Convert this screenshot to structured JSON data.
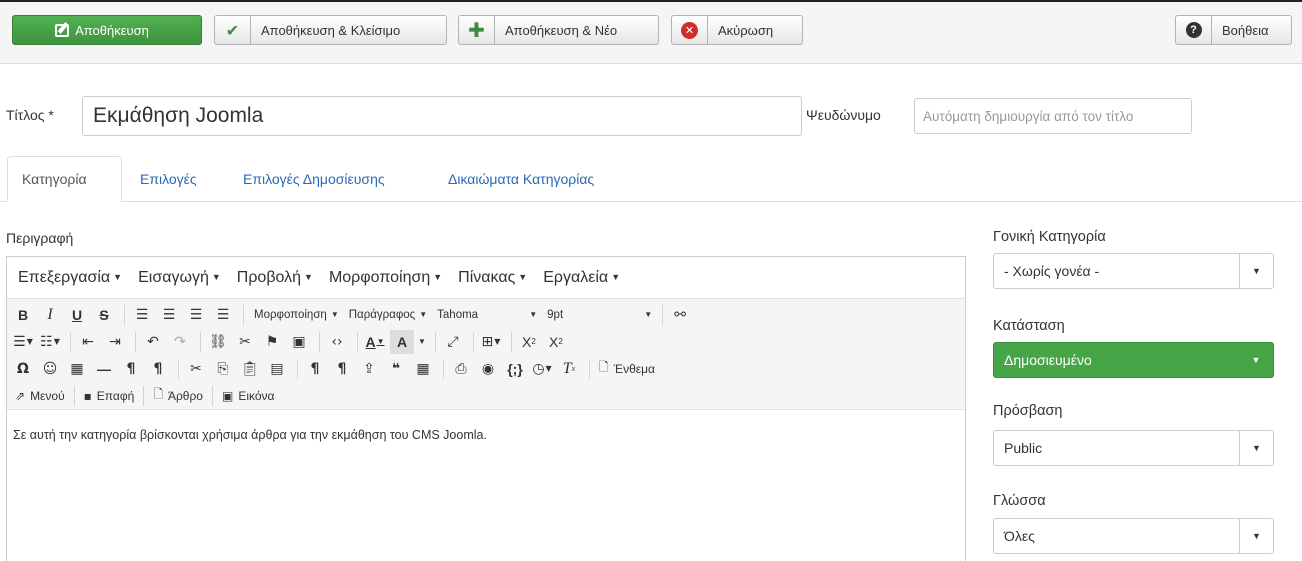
{
  "toolbar": {
    "save": "Αποθήκευση",
    "save_close": "Αποθήκευση & Κλείσιμο",
    "save_new": "Αποθήκευση & Νέο",
    "cancel": "Ακύρωση",
    "help": "Βοήθεια"
  },
  "form": {
    "title_label": "Τίτλος *",
    "title_value": "Εκμάθηση Joomla",
    "alias_label": "Ψευδώνυμο",
    "alias_placeholder": "Αυτόματη δημιουργία από τον τίτλο"
  },
  "tabs": [
    "Κατηγορία",
    "Επιλογές",
    "Επιλογές Δημοσίευσης",
    "Δικαιώματα Κατηγορίας"
  ],
  "editor": {
    "label": "Περιγραφή",
    "menus": [
      "Επεξεργασία",
      "Εισαγωγή",
      "Προβολή",
      "Μορφοποίηση",
      "Πίνακας",
      "Εργαλεία"
    ],
    "format_dropdown": "Μορφοποίηση",
    "block_dropdown": "Παράγραφος",
    "font_dropdown": "Tahoma",
    "size_dropdown": "9pt",
    "embed_button": "Ένθεμα",
    "menu_button": "Μενού",
    "contact_button": "Επαφή",
    "article_button": "Άρθρο",
    "image_button": "Εικόνα",
    "content": "Σε αυτή την κατηγορία βρίσκονται χρήσιμα άρθρα για την εκμάθηση του CMS Joomla."
  },
  "sidebar": {
    "parent_label": "Γονική Κατηγορία",
    "parent_value": "- Χωρίς γονέα -",
    "status_label": "Κατάσταση",
    "status_value": "Δημοσιευμένο",
    "access_label": "Πρόσβαση",
    "access_value": "Public",
    "language_label": "Γλώσσα",
    "language_value": "Όλες"
  },
  "colors": {
    "save_green": "#46a546",
    "link_blue": "#2a69b8",
    "cancel_red": "#c9302c"
  }
}
